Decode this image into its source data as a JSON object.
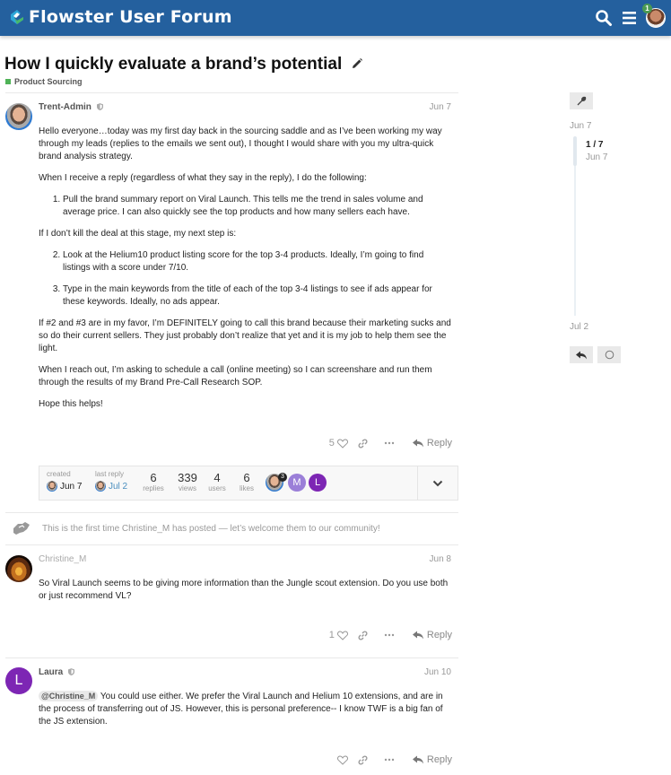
{
  "header": {
    "site_title": "Flowster User Forum",
    "notification_count": "1",
    "brand_color": "#24609e"
  },
  "topic": {
    "title": "How I quickly evaluate a brand’s potential",
    "category": "Product Sourcing",
    "category_color": "#4fb357"
  },
  "posts": [
    {
      "username": "Trent-Admin",
      "date": "Jun 7",
      "paragraphs": [
        "Hello everyone…today was my first day back in the sourcing saddle and as I’ve been working my way through my leads (replies to the emails we sent out), I thought I would share with you my ultra-quick brand analysis strategy.",
        "When I receive a reply (regardless of what they say in the reply), I do the following:",
        "If I don’t kill the deal at this stage, my next step is:",
        "If #2 and #3 are in my favor, I’m DEFINITELY going to call this brand because their marketing sucks and so do their current sellers. They just probably don’t realize that yet and it is my job to help them see the light.",
        "When I reach out, I’m asking to schedule a call (online meeting) so I can screenshare and run them through the results of my Brand Pre-Call Research SOP.",
        "Hope this helps!"
      ],
      "list_items": [
        "Pull the brand summary report on Viral Launch. This tells me the trend in sales volume and average price. I can also quickly see the top products and how many sellers each have.",
        "Look at the Helium10 product listing score for the top 3-4 products. Ideally, I’m going to find listings with a score under 7/10.",
        "Type in the main keywords from the title of each of the top 3-4 listings to see if ads appear for these keywords. Ideally, no ads appear."
      ],
      "likes": "5",
      "reply_label": "Reply"
    },
    {
      "username": "Christine_M",
      "date": "Jun 8",
      "body": "So Viral Launch seems to be giving more information than the Jungle scout extension. Do you use both or just recommend VL?",
      "likes": "1",
      "reply_label": "Reply"
    },
    {
      "username": "Laura",
      "avatar_letter": "L",
      "date": "Jun 10",
      "mention": "@Christine_M",
      "body": " You could use either. We prefer the Viral Launch and Helium 10 extensions, and are in the process of transferring out of JS. However, this is personal preference-- I know TWF is a big fan of the JS extension.",
      "likes": "",
      "reply_label": "Reply"
    }
  ],
  "topic_map": {
    "created_label": "created",
    "created_date": "Jun 7",
    "last_reply_label": "last reply",
    "last_reply_date": "Jul 2",
    "stats": [
      {
        "num": "6",
        "label": "replies"
      },
      {
        "num": "339",
        "label": "views"
      },
      {
        "num": "4",
        "label": "users"
      },
      {
        "num": "6",
        "label": "likes"
      }
    ],
    "participants": [
      {
        "letter": "",
        "count": "3"
      },
      {
        "letter": "M",
        "color": "#9b7fd8"
      },
      {
        "letter": "L",
        "color": "#7d26b4"
      }
    ]
  },
  "small_action": "This is the first time Christine_M has posted — let’s welcome them to our community!",
  "timeline": {
    "start_date": "Jun 7",
    "position": "1 / 7",
    "position_date": "Jun 7",
    "end_date": "Jul 2"
  }
}
